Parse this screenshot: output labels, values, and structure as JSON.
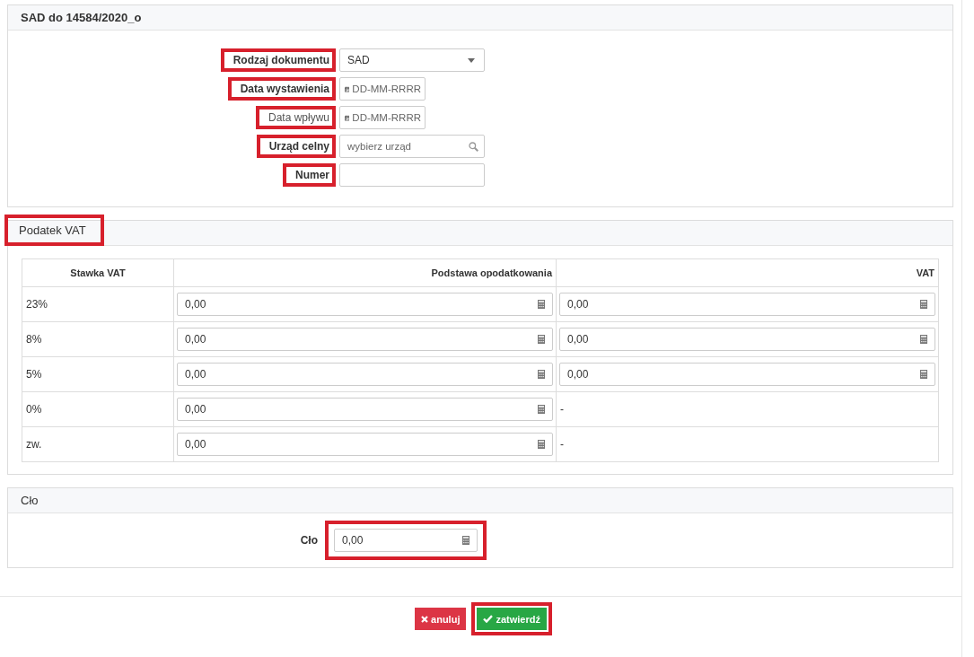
{
  "document_panel": {
    "title": "SAD do 14584/2020_o",
    "fields": [
      {
        "label": "Rodzaj dokumentu",
        "label_bold": true,
        "highlighted": true,
        "kind": "select",
        "value": "SAD"
      },
      {
        "label": "Data wystawienia",
        "label_bold": true,
        "highlighted": true,
        "kind": "date",
        "placeholder": "DD-MM-RRRR"
      },
      {
        "label": "Data wpływu",
        "label_bold": false,
        "highlighted": true,
        "kind": "date",
        "placeholder": "DD-MM-RRRR"
      },
      {
        "label": "Urząd celny",
        "label_bold": true,
        "highlighted": true,
        "kind": "search",
        "placeholder": "wybierz urząd"
      },
      {
        "label": "Numer",
        "label_bold": true,
        "highlighted": true,
        "kind": "text"
      }
    ]
  },
  "vat_panel": {
    "title": "Podatek VAT",
    "title_highlighted": true,
    "table": {
      "columns": [
        "Stawka VAT",
        "Podstawa opodatkowania",
        "VAT"
      ],
      "rows": [
        {
          "rate": "23%",
          "base": "0,00",
          "vat": {
            "kind": "input",
            "value": "0,00"
          }
        },
        {
          "rate": "8%",
          "base": "0,00",
          "vat": {
            "kind": "input",
            "value": "0,00"
          }
        },
        {
          "rate": "5%",
          "base": "0,00",
          "vat": {
            "kind": "input",
            "value": "0,00"
          }
        },
        {
          "rate": "0%",
          "base": "0,00",
          "vat": {
            "kind": "text",
            "value": "-"
          }
        },
        {
          "rate": "zw.",
          "base": "0,00",
          "vat": {
            "kind": "text",
            "value": "-"
          }
        }
      ]
    }
  },
  "duty_panel": {
    "title": "Cło",
    "field": {
      "label": "Cło",
      "highlighted": true,
      "value": "0,00"
    }
  },
  "buttons": [
    {
      "kind": "cancel",
      "label": "anuluj",
      "highlighted": false
    },
    {
      "kind": "confirm",
      "label": "zatwierdź",
      "highlighted": true
    }
  ]
}
